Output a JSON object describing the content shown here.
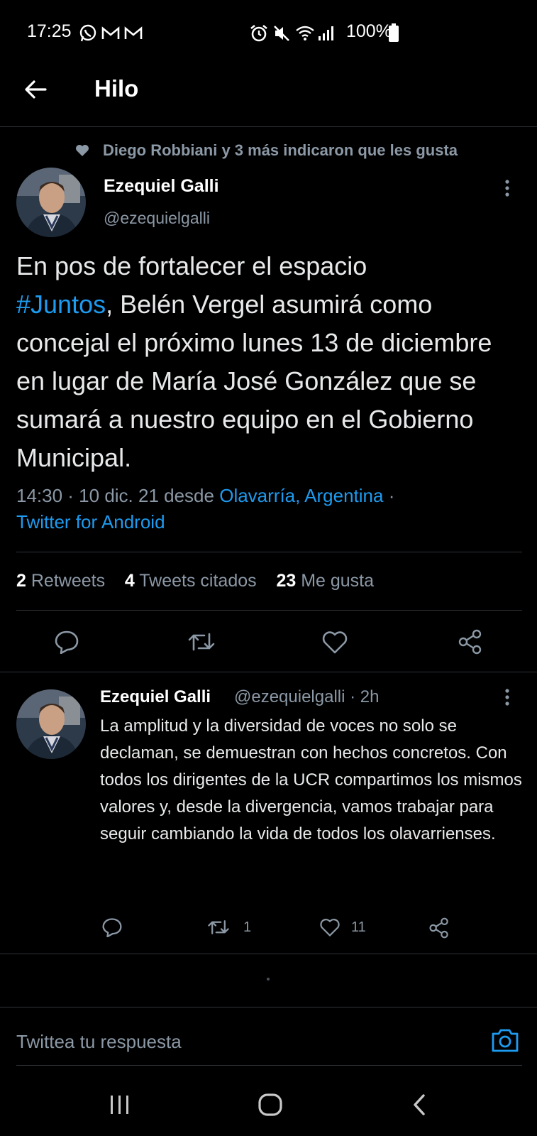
{
  "status_bar": {
    "time": "17:25",
    "battery": "100%",
    "icons": [
      "whatsapp-icon",
      "gmail-icon",
      "gmail-icon",
      "alarm-icon",
      "mute-icon",
      "wifi-icon",
      "signal-icon",
      "battery-icon"
    ]
  },
  "header": {
    "title": "Hilo"
  },
  "social_context": {
    "text": "Diego Robbiani y 3 más indicaron que les gusta"
  },
  "tweet": {
    "author_name": "Ezequiel Galli",
    "author_handle": "@ezequielgalli",
    "text_before": "En pos de fortalecer el espacio",
    "hashtag": "#Juntos",
    "text_after": ", Belén Vergel asumirá como concejal el próximo lunes 13 de diciembre en lugar de María José González que se sumará a nuestro equipo en el Gobierno Municipal.",
    "time": "14:30 · 10 dic. 21 desde",
    "location": "Olavarría, Argentina",
    "sep": "·",
    "source": "Twitter for Android",
    "retweets_count": "2",
    "retweets_label": "Retweets",
    "quotes_count": "4",
    "quotes_label": "Tweets citados",
    "likes_count": "23",
    "likes_label": "Me gusta"
  },
  "reply": {
    "author_name": "Ezequiel Galli",
    "author_handle": "@ezequielgalli · 2h",
    "text": "La amplitud y la diversidad de voces no solo se declaman, se demuestran con hechos concretos. Con todos los dirigentes de la UCR compartimos los mismos valores y, desde la divergencia, vamos trabajar para seguir cambiando la vida de todos los olavarrienses.",
    "retweets": "1",
    "likes": "11"
  },
  "compose": {
    "placeholder": "Twittea tu respuesta"
  },
  "colors": {
    "accent": "#1d9bf0",
    "background": "#000000",
    "secondary_text": "#8b98a5"
  }
}
